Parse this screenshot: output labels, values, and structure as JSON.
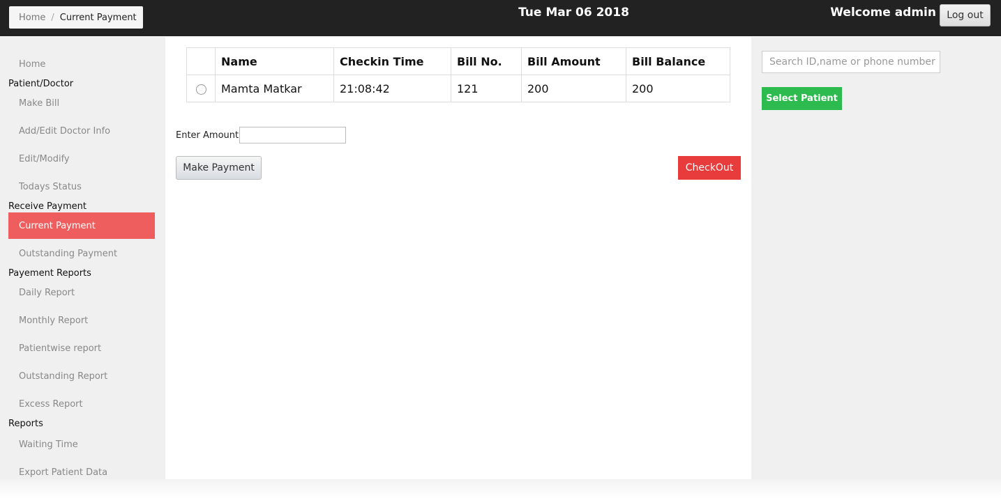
{
  "header": {
    "breadcrumb_home": "Home",
    "breadcrumb_separator": "/",
    "breadcrumb_current": "Current Payment",
    "date": "Tue Mar 06 2018",
    "welcome": "Welcome admin",
    "logout_label": "Log out"
  },
  "sidebar": {
    "items": [
      {
        "type": "link",
        "label": "Home"
      },
      {
        "type": "section",
        "label": "Patient/Doctor"
      },
      {
        "type": "link",
        "label": "Make Bill"
      },
      {
        "type": "link",
        "label": "Add/Edit Doctor Info"
      },
      {
        "type": "link",
        "label": "Edit/Modify"
      },
      {
        "type": "link",
        "label": "Todays Status"
      },
      {
        "type": "section",
        "label": "Receive Payment"
      },
      {
        "type": "active",
        "label": "Current Payment"
      },
      {
        "type": "link",
        "label": "Outstanding Payment"
      },
      {
        "type": "section",
        "label": "Payement Reports"
      },
      {
        "type": "link",
        "label": "Daily Report"
      },
      {
        "type": "link",
        "label": "Monthly Report"
      },
      {
        "type": "link",
        "label": "Patientwise report"
      },
      {
        "type": "link",
        "label": "Outstanding Report"
      },
      {
        "type": "link",
        "label": "Excess Report"
      },
      {
        "type": "section",
        "label": "Reports"
      },
      {
        "type": "link",
        "label": "Waiting Time"
      },
      {
        "type": "link",
        "label": "Export Patient Data"
      }
    ]
  },
  "table": {
    "headers": [
      "Name",
      "Checkin Time",
      "Bill No.",
      "Bill Amount",
      "Bill Balance"
    ],
    "rows": [
      {
        "name": "Mamta Matkar",
        "checkin_time": "21:08:42",
        "bill_no": "121",
        "bill_amount": "200",
        "bill_balance": "200"
      }
    ]
  },
  "payment": {
    "amount_label": "Enter Amount:",
    "amount_value": "",
    "make_payment_label": "Make Payment",
    "checkout_label": "CheckOut"
  },
  "search": {
    "placeholder": "Search ID,name or phone number",
    "select_label": "Select Patient"
  },
  "colors": {
    "topbar": "#222222",
    "active_item": "#ee5e5e",
    "checkout": "#e83b3b",
    "select_patient": "#2dba4e"
  }
}
